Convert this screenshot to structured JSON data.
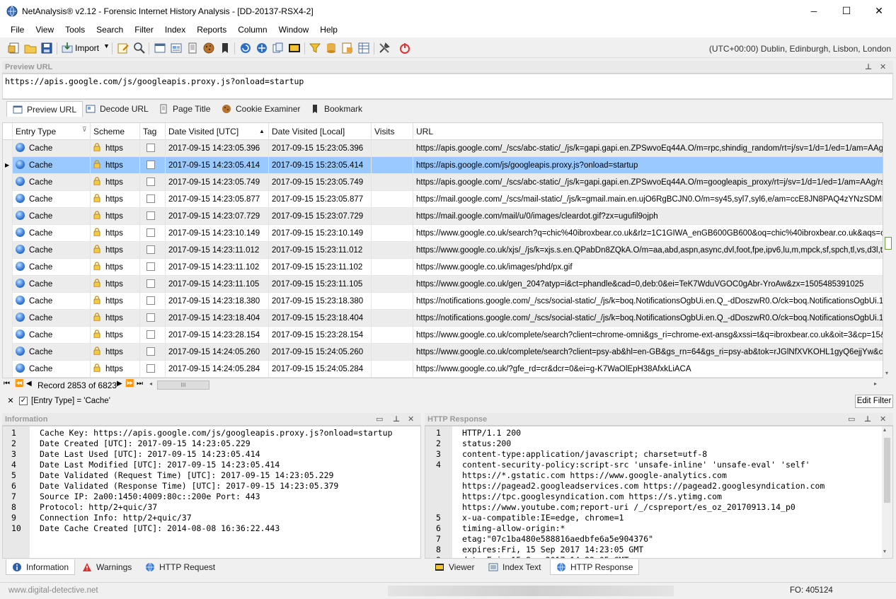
{
  "window": {
    "title": "NetAnalysis® v2.12 - Forensic Internet History Analysis - [DD-20137-RSX4-2]",
    "minimize": "─",
    "maximize": "☐",
    "close": "✕"
  },
  "menu": [
    "File",
    "View",
    "Tools",
    "Search",
    "Filter",
    "Index",
    "Reports",
    "Column",
    "Window",
    "Help"
  ],
  "toolbar": {
    "import_label": "Import",
    "timezone": "(UTC+00:00) Dublin, Edinburgh, Lisbon, London"
  },
  "preview": {
    "header": "Preview URL",
    "url": "https://apis.google.com/js/googleapis.proxy.js?onload=startup",
    "tabs": [
      "Preview URL",
      "Decode URL",
      "Page Title",
      "Cookie Examiner",
      "Bookmark"
    ]
  },
  "grid": {
    "columns": [
      "Entry Type",
      "Scheme",
      "Tag",
      "Date Visited [UTC]",
      "Date Visited [Local]",
      "Visits",
      "URL"
    ],
    "rows": [
      {
        "type": "Cache",
        "scheme": "https",
        "utc": "2017-09-15 14:23:05.396",
        "local": "2017-09-15 15:23:05.396",
        "url": "https://apis.google.com/_/scs/abc-static/_/js/k=gapi.gapi.en.ZPSwvoEq44A.O/m=rpc,shindig_random/rt=j/sv=1/d=1/ed=1/am=AAg/rs"
      },
      {
        "type": "Cache",
        "scheme": "https",
        "utc": "2017-09-15 14:23:05.414",
        "local": "2017-09-15 15:23:05.414",
        "url": "https://apis.google.com/js/googleapis.proxy.js?onload=startup"
      },
      {
        "type": "Cache",
        "scheme": "https",
        "utc": "2017-09-15 14:23:05.749",
        "local": "2017-09-15 15:23:05.749",
        "url": "https://apis.google.com/_/scs/abc-static/_/js/k=gapi.gapi.en.ZPSwvoEq44A.O/m=googleapis_proxy/rt=j/sv=1/d=1/ed=1/am=AAg/rs"
      },
      {
        "type": "Cache",
        "scheme": "https",
        "utc": "2017-09-15 14:23:05.877",
        "local": "2017-09-15 15:23:05.877",
        "url": "https://mail.google.com/_/scs/mail-static/_/js/k=gmail.main.en.ujO6RgBCJN0.O/m=sy45,syl7,syl6,e/am=ccE8JN8PAQ4zYNzSDMLs__zl0v"
      },
      {
        "type": "Cache",
        "scheme": "https",
        "utc": "2017-09-15 14:23:07.729",
        "local": "2017-09-15 15:23:07.729",
        "url": "https://mail.google.com/mail/u/0/images/cleardot.gif?zx=ugufil9ojph"
      },
      {
        "type": "Cache",
        "scheme": "https",
        "utc": "2017-09-15 14:23:10.149",
        "local": "2017-09-15 15:23:10.149",
        "url": "https://www.google.co.uk/search?q=chic%40ibroxbear.co.uk&rlz=1C1GIWA_enGB600GB600&oq=chic%40ibroxbear.co.uk&aqs=chrome"
      },
      {
        "type": "Cache",
        "scheme": "https",
        "utc": "2017-09-15 14:23:11.012",
        "local": "2017-09-15 15:23:11.012",
        "url": "https://www.google.co.uk/xjs/_/js/k=xjs.s.en.QPabDn8ZQkA.O/m=aa,abd,aspn,async,dvl,foot,fpe,ipv6,lu,m,mpck,sf,spch,tl,vs,d3l,tnv"
      },
      {
        "type": "Cache",
        "scheme": "https",
        "utc": "2017-09-15 14:23:11.102",
        "local": "2017-09-15 15:23:11.102",
        "url": "https://www.google.co.uk/images/phd/px.gif"
      },
      {
        "type": "Cache",
        "scheme": "https",
        "utc": "2017-09-15 14:23:11.105",
        "local": "2017-09-15 15:23:11.105",
        "url": "https://www.google.co.uk/gen_204?atyp=i&ct=phandle&cad=0,deb:0&ei=TeK7WduVGOC0gAbr-YroAw&zx=1505485391025"
      },
      {
        "type": "Cache",
        "scheme": "https",
        "utc": "2017-09-15 14:23:18.380",
        "local": "2017-09-15 15:23:18.380",
        "url": "https://notifications.google.com/_/scs/social-static/_/js/k=boq.NotificationsOgbUi.en.Q_-dDoszwR0.O/ck=boq.NotificationsOgbUi.1cyl4j9"
      },
      {
        "type": "Cache",
        "scheme": "https",
        "utc": "2017-09-15 14:23:18.404",
        "local": "2017-09-15 15:23:18.404",
        "url": "https://notifications.google.com/_/scs/social-static/_/js/k=boq.NotificationsOgbUi.en.Q_-dDoszwR0.O/ck=boq.NotificationsOgbUi.1cyl4j9"
      },
      {
        "type": "Cache",
        "scheme": "https",
        "utc": "2017-09-15 14:23:28.154",
        "local": "2017-09-15 15:23:28.154",
        "url": "https://www.google.co.uk/complete/search?client=chrome-omni&gs_ri=chrome-ext-ansg&xssi=t&q=ibroxbear.co.uk&oit=3&cp=15&pgcl"
      },
      {
        "type": "Cache",
        "scheme": "https",
        "utc": "2017-09-15 14:24:05.260",
        "local": "2017-09-15 15:24:05.260",
        "url": "https://www.google.co.uk/complete/search?client=psy-ab&hl=en-GB&gs_rn=64&gs_ri=psy-ab&tok=rJGlNfXVKOHL1gyQ6ejjYw&cp=0&gs"
      },
      {
        "type": "Cache",
        "scheme": "https",
        "utc": "2017-09-15 14:24:05.284",
        "local": "2017-09-15 15:24:05.284",
        "url": "https://www.google.co.uk/?gfe_rd=cr&dcr=0&ei=g-K7WaOlEpH38AfxkLiACA"
      }
    ],
    "record_label": "Record 2853 of 6823"
  },
  "filter": {
    "text": "[Entry Type] = 'Cache'",
    "edit_label": "Edit Filter"
  },
  "info": {
    "header": "Information",
    "lines": [
      "Cache Key: https://apis.google.com/js/googleapis.proxy.js?onload=startup",
      "Date Created [UTC]: 2017-09-15 14:23:05.229",
      "Date Last Used [UTC]: 2017-09-15 14:23:05.414",
      "Date Last Modified [UTC]: 2017-09-15 14:23:05.414",
      "Date Validated (Request Time) [UTC]: 2017-09-15 14:23:05.229",
      "Date Validated (Response Time) [UTC]: 2017-09-15 14:23:05.379",
      "Source IP: 2a00:1450:4009:80c::200e Port: 443",
      "Protocol: http/2+quic/37",
      "Connection Info: http/2+quic/37",
      "Date Cache Created [UTC]: 2014-08-08 16:36:22.443"
    ],
    "tabs": [
      "Information",
      "Warnings",
      "HTTP Request"
    ]
  },
  "http": {
    "header": "HTTP Response",
    "lines": [
      {
        "n": "1",
        "t": "HTTP/1.1 200"
      },
      {
        "n": "2",
        "t": "status:200"
      },
      {
        "n": "3",
        "t": "content-type:application/javascript; charset=utf-8"
      },
      {
        "n": "4",
        "t": "content-security-policy:script-src 'unsafe-inline' 'unsafe-eval' 'self'"
      },
      {
        "n": "",
        "t": "https://*.gstatic.com https://www.google-analytics.com"
      },
      {
        "n": "",
        "t": "https://pagead2.googleadservices.com https://pagead2.googlesyndication.com"
      },
      {
        "n": "",
        "t": "https://tpc.googlesyndication.com https://s.ytimg.com"
      },
      {
        "n": "",
        "t": "https://www.youtube.com;report-uri /_/cspreport/es_oz_20170913.14_p0"
      },
      {
        "n": "5",
        "t": "x-ua-compatible:IE=edge, chrome=1"
      },
      {
        "n": "6",
        "t": "timing-allow-origin:*"
      },
      {
        "n": "7",
        "t": "etag:\"07c1ba480e588816aedbfe6a5e904376\""
      },
      {
        "n": "8",
        "t": "expires:Fri, 15 Sep 2017 14:23:05 GMT"
      },
      {
        "n": "9",
        "t": "date:Fri, 15 Sep 2017 14:23:05 GMT"
      }
    ],
    "tabs": [
      "Viewer",
      "Index Text",
      "HTTP Response"
    ]
  },
  "status": {
    "website": "www.digital-detective.net",
    "fo": "FO: 405124"
  }
}
